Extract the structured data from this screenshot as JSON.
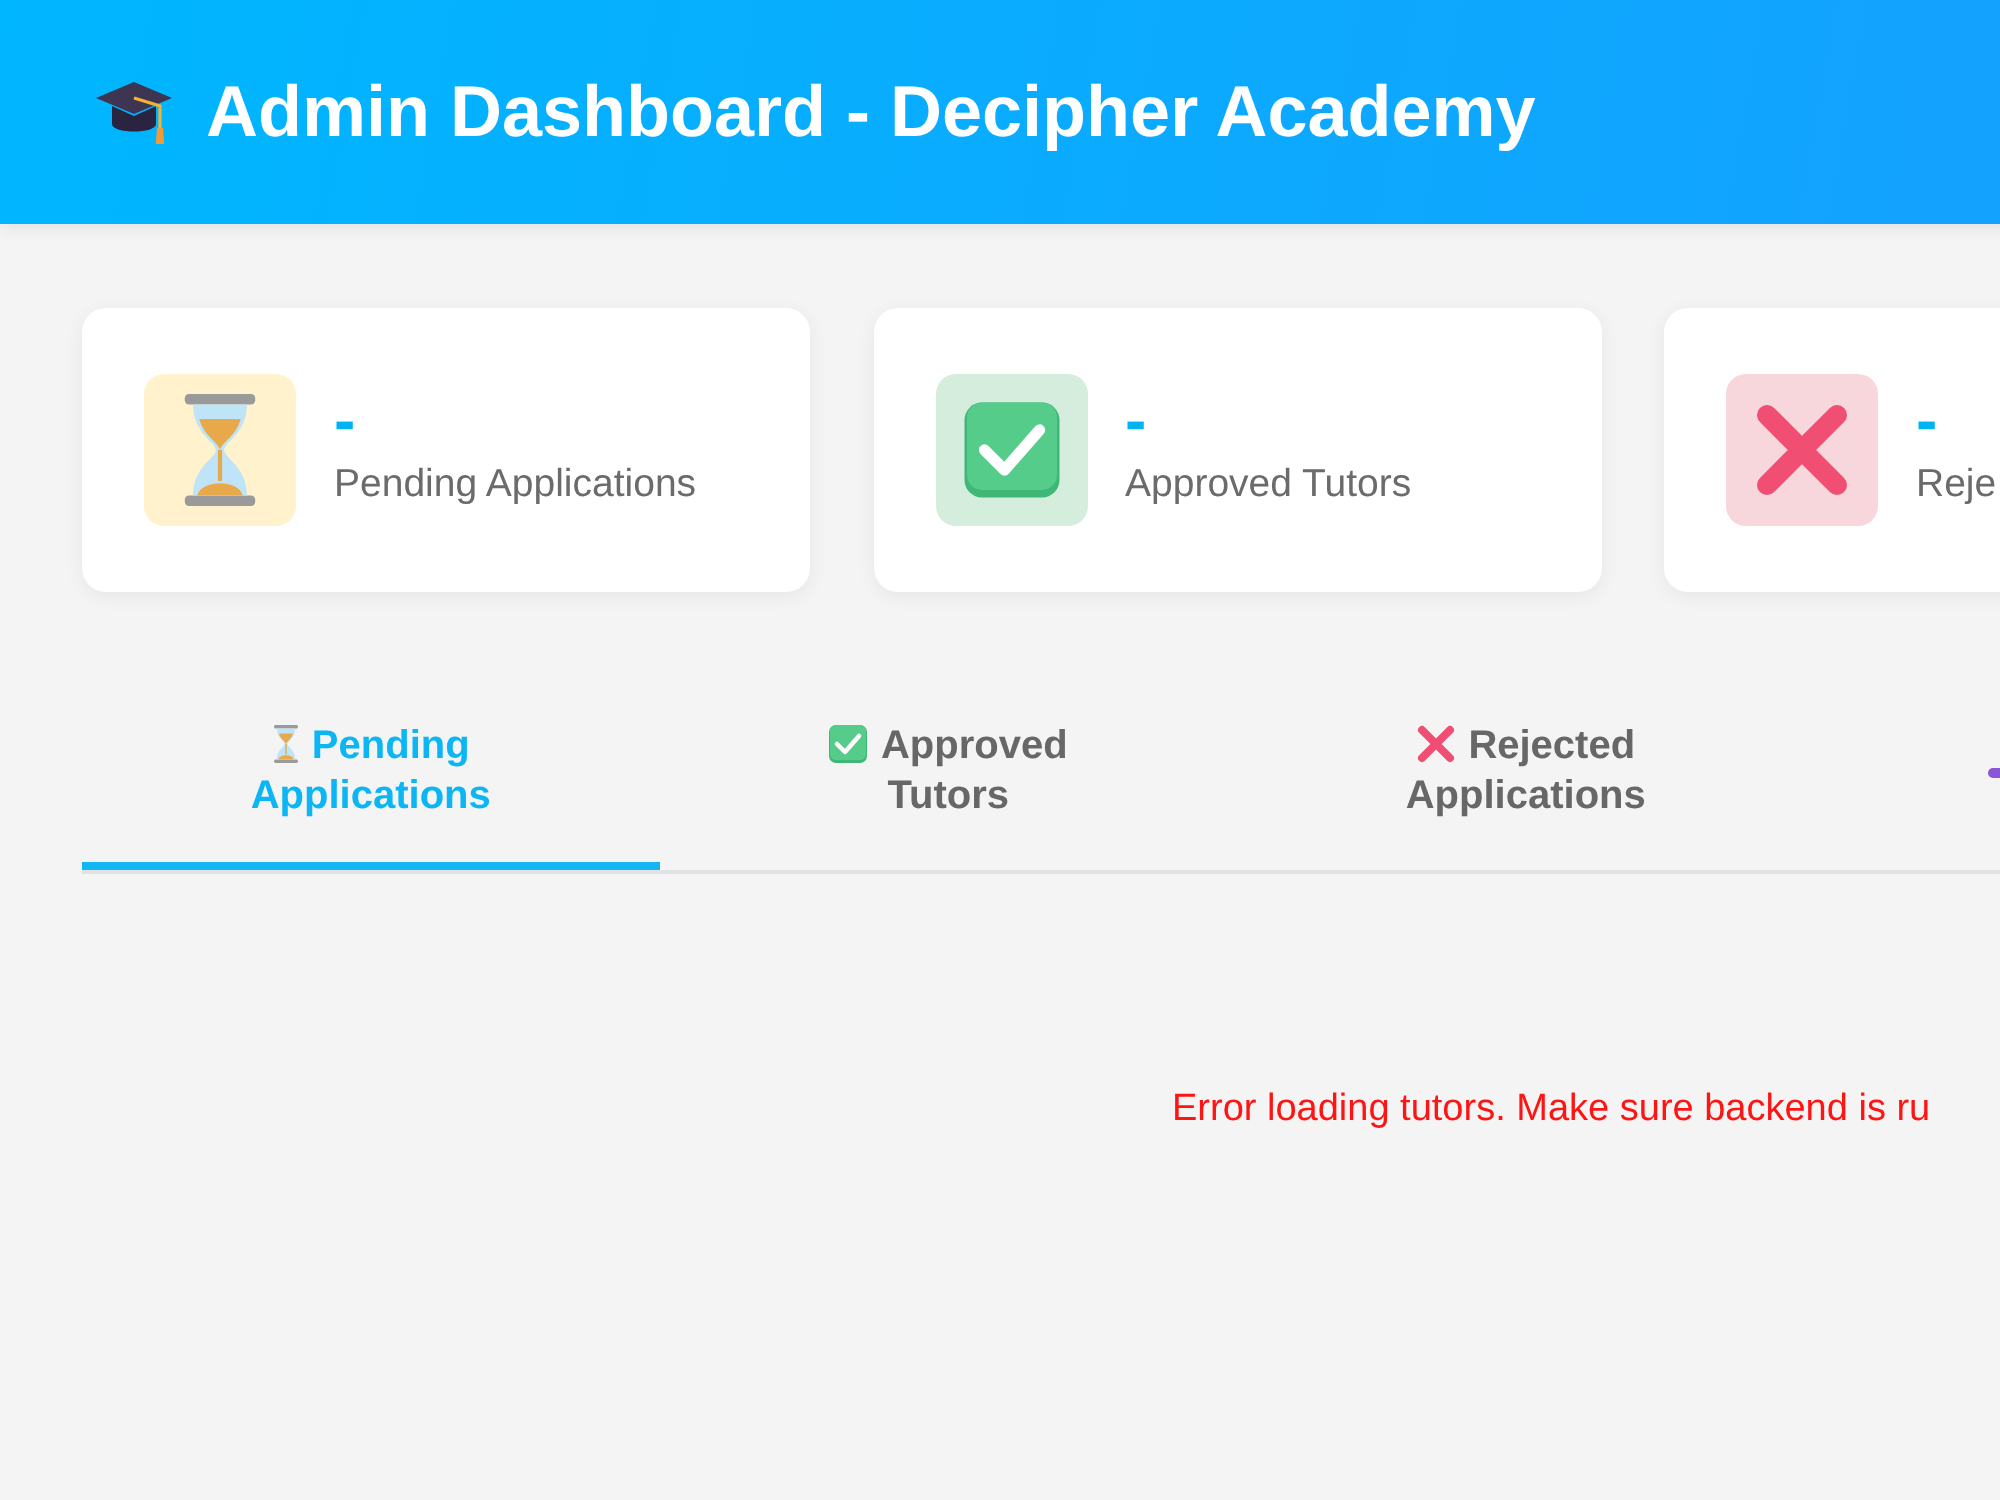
{
  "header": {
    "title": "Admin Dashboard - Decipher Academy"
  },
  "stats": [
    {
      "kind": "pending",
      "value": "-",
      "label": "Pending Applications"
    },
    {
      "kind": "approved",
      "value": "-",
      "label": "Approved Tutors"
    },
    {
      "kind": "rejected",
      "value": "-",
      "label": "Reje"
    }
  ],
  "tabs": [
    {
      "kind": "pending",
      "label": "Pending Applications",
      "selected": true
    },
    {
      "kind": "approved",
      "label": "Approved Tutors",
      "selected": false
    },
    {
      "kind": "rejected",
      "label": "Rejected Applications",
      "selected": false
    },
    {
      "kind": "other",
      "selected": false
    }
  ],
  "message": {
    "kind": "error",
    "text": "Error loading tutors. Make sure backend is ru"
  }
}
